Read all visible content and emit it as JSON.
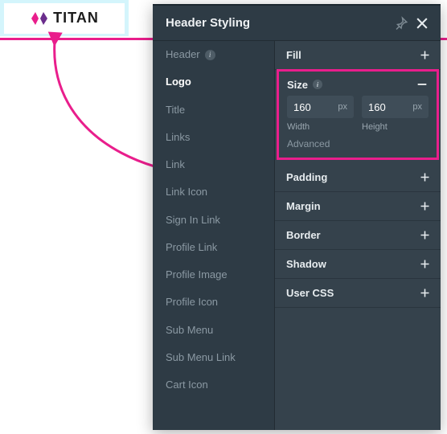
{
  "logo": {
    "text": "TITAN"
  },
  "panel_title": "Header Styling",
  "sidebar": {
    "items": [
      {
        "label": "Header",
        "info": true
      },
      {
        "label": "Logo"
      },
      {
        "label": "Title"
      },
      {
        "label": "Links"
      },
      {
        "label": "Link"
      },
      {
        "label": "Link Icon"
      },
      {
        "label": "Sign In Link"
      },
      {
        "label": "Profile Link"
      },
      {
        "label": "Profile Image"
      },
      {
        "label": "Profile Icon"
      },
      {
        "label": "Sub Menu"
      },
      {
        "label": "Sub Menu Link"
      },
      {
        "label": "Cart Icon"
      }
    ],
    "active_index": 1
  },
  "sections": {
    "fill": {
      "label": "Fill"
    },
    "size": {
      "label": "Size",
      "width": {
        "value": "160",
        "unit": "px",
        "label": "Width"
      },
      "height": {
        "value": "160",
        "unit": "px",
        "label": "Height"
      },
      "advanced": "Advanced"
    },
    "padding": {
      "label": "Padding"
    },
    "margin": {
      "label": "Margin"
    },
    "border": {
      "label": "Border"
    },
    "shadow": {
      "label": "Shadow"
    },
    "usercss": {
      "label": "User CSS"
    }
  },
  "colors": {
    "accent": "#e91e8c"
  }
}
